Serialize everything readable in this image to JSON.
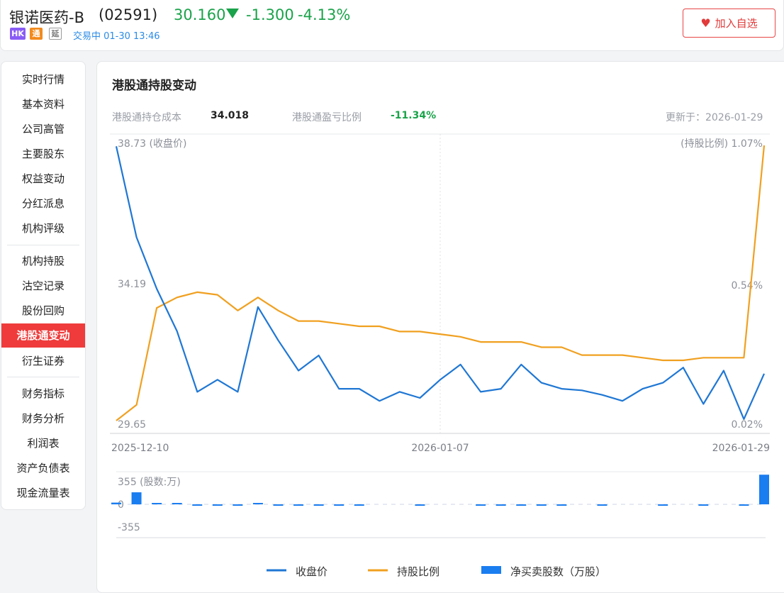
{
  "header": {
    "stock_name": "银诺医药-B",
    "stock_code": "(02591)",
    "price": "30.160",
    "change": "-1.300",
    "change_pct": "-4.13%",
    "badges": [
      "HK",
      "通",
      "延"
    ],
    "trade_status": "交易中 01-30 13:46",
    "watch_button": "加入自选",
    "colors": {
      "down": "#1aa34a",
      "accent": "#e23a3a"
    }
  },
  "sidebar": {
    "items": [
      {
        "label": "实时行情"
      },
      {
        "label": "基本资料"
      },
      {
        "label": "公司高管"
      },
      {
        "label": "主要股东"
      },
      {
        "label": "权益变动"
      },
      {
        "label": "分红派息"
      },
      {
        "label": "机构评级"
      },
      {
        "label": "机构持股"
      },
      {
        "label": "沽空记录"
      },
      {
        "label": "股份回购"
      },
      {
        "label": "港股通变动",
        "active": true
      },
      {
        "label": "衍生证券"
      },
      {
        "label": "财务指标"
      },
      {
        "label": "财务分析"
      },
      {
        "label": "利润表"
      },
      {
        "label": "资产负债表"
      },
      {
        "label": "现金流量表"
      }
    ]
  },
  "main": {
    "title": "港股通持股变动",
    "cost_label": "港股通持仓成本",
    "cost_value": "34.018",
    "pnl_label": "港股通盈亏比例",
    "pnl_value": "-11.34%",
    "updated": "更新于：2026-01-29"
  },
  "chart_data": {
    "type": "line",
    "x_ticks": [
      "2025-12-10",
      "2026-01-07",
      "2026-01-29"
    ],
    "left_axis": {
      "ticks": [
        "38.73 (收盘价)",
        "34.19",
        "29.65"
      ],
      "range": [
        29.65,
        38.73
      ]
    },
    "right_axis": {
      "ticks": [
        "(持股比例) 1.07%",
        "0.54%",
        "0.02%"
      ],
      "range": [
        0.02,
        1.07
      ]
    },
    "bar_axis": {
      "ticks": [
        "355 (股数:万)",
        "0",
        "-355"
      ],
      "range": [
        -355,
        355
      ]
    },
    "series": [
      {
        "name": "收盘价",
        "color": "#1f77d4",
        "values": [
          38.7,
          35.7,
          34.0,
          32.6,
          30.6,
          31.0,
          30.6,
          33.4,
          32.3,
          31.3,
          31.8,
          30.7,
          30.7,
          30.3,
          30.6,
          30.4,
          31.0,
          31.5,
          30.6,
          30.7,
          31.5,
          30.9,
          30.7,
          30.65,
          30.5,
          30.3,
          30.7,
          30.9,
          31.4,
          30.2,
          31.3,
          29.7,
          31.2
        ]
      },
      {
        "name": "持股比例",
        "color": "#f0a020",
        "values": [
          0.02,
          0.08,
          0.45,
          0.49,
          0.51,
          0.5,
          0.44,
          0.49,
          0.44,
          0.4,
          0.4,
          0.39,
          0.38,
          0.38,
          0.36,
          0.36,
          0.35,
          0.34,
          0.32,
          0.32,
          0.32,
          0.3,
          0.3,
          0.27,
          0.27,
          0.27,
          0.26,
          0.25,
          0.25,
          0.26,
          0.26,
          0.26,
          1.07
        ]
      },
      {
        "name": "净买卖股数（万股）",
        "color": "#1a7df0",
        "values": [
          20,
          140,
          8,
          5,
          -5,
          -6,
          -12,
          10,
          -8,
          -12,
          -10,
          -3,
          -2,
          0,
          0,
          -3,
          0,
          0,
          -2,
          -3,
          -2,
          -3,
          -3,
          0,
          -3,
          0,
          0,
          -3,
          0,
          -3,
          0,
          -3,
          345
        ]
      }
    ],
    "grid": true,
    "legend_position": "bottom"
  }
}
